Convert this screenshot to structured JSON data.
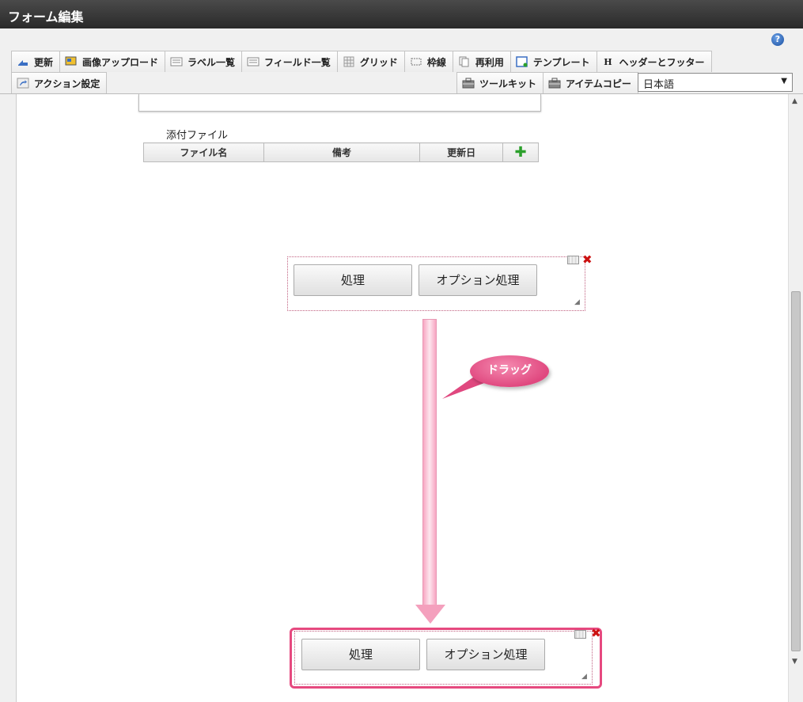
{
  "window": {
    "title": "フォーム編集"
  },
  "toolbar": {
    "row1": [
      {
        "label": "更新",
        "icon": "update-icon"
      },
      {
        "label": "画像アップロード",
        "icon": "image-upload-icon"
      },
      {
        "label": "ラベル一覧",
        "icon": "label-list-icon"
      },
      {
        "label": "フィールド一覧",
        "icon": "field-list-icon"
      },
      {
        "label": "グリッド",
        "icon": "grid-icon"
      },
      {
        "label": "枠線",
        "icon": "border-icon"
      },
      {
        "label": "再利用",
        "icon": "reuse-icon"
      },
      {
        "label": "テンプレート",
        "icon": "template-icon"
      },
      {
        "label": "ヘッダーとフッター",
        "icon": "header-footer-icon"
      }
    ],
    "row2_left": [
      {
        "label": "アクション設定",
        "icon": "action-settings-icon"
      }
    ],
    "row2_right": [
      {
        "label": "ツールキット",
        "icon": "toolkit-icon"
      },
      {
        "label": "アイテムコピー",
        "icon": "item-copy-icon"
      }
    ],
    "language": "日本語",
    "help": "?"
  },
  "attachments": {
    "label": "添付ファイル",
    "columns": [
      "ファイル名",
      "備考",
      "更新日"
    ]
  },
  "widget_top": {
    "button1": "処理",
    "button2": "オプション処理"
  },
  "widget_bottom": {
    "button1": "処理",
    "button2": "オプション処理"
  },
  "callout": {
    "text": "ドラッグ"
  },
  "colors": {
    "accent": "#e6497f",
    "arrow": "#f4a0bd"
  }
}
